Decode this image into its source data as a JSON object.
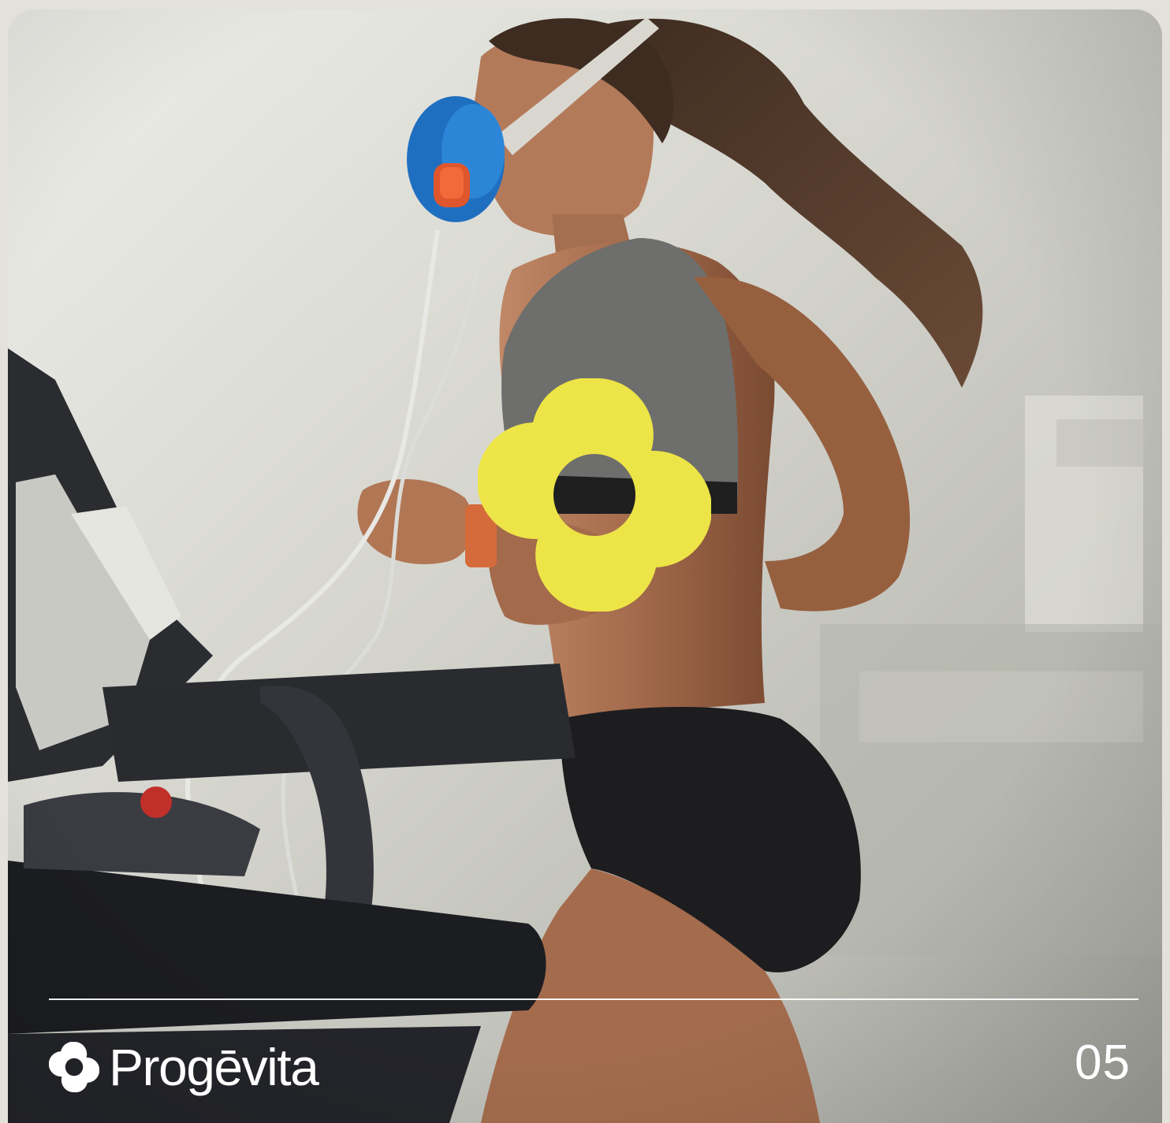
{
  "photo": {
    "subject": "woman-running-on-treadmill-with-metabolic-mask"
  },
  "center_mark": {
    "icon": "progevita-logo-mark",
    "color": "#EDE447"
  },
  "footer": {
    "brand_icon": "progevita-logo-icon",
    "brand_name": "Progēvita",
    "slide_number": "05",
    "text_color": "#FFFFFF"
  }
}
